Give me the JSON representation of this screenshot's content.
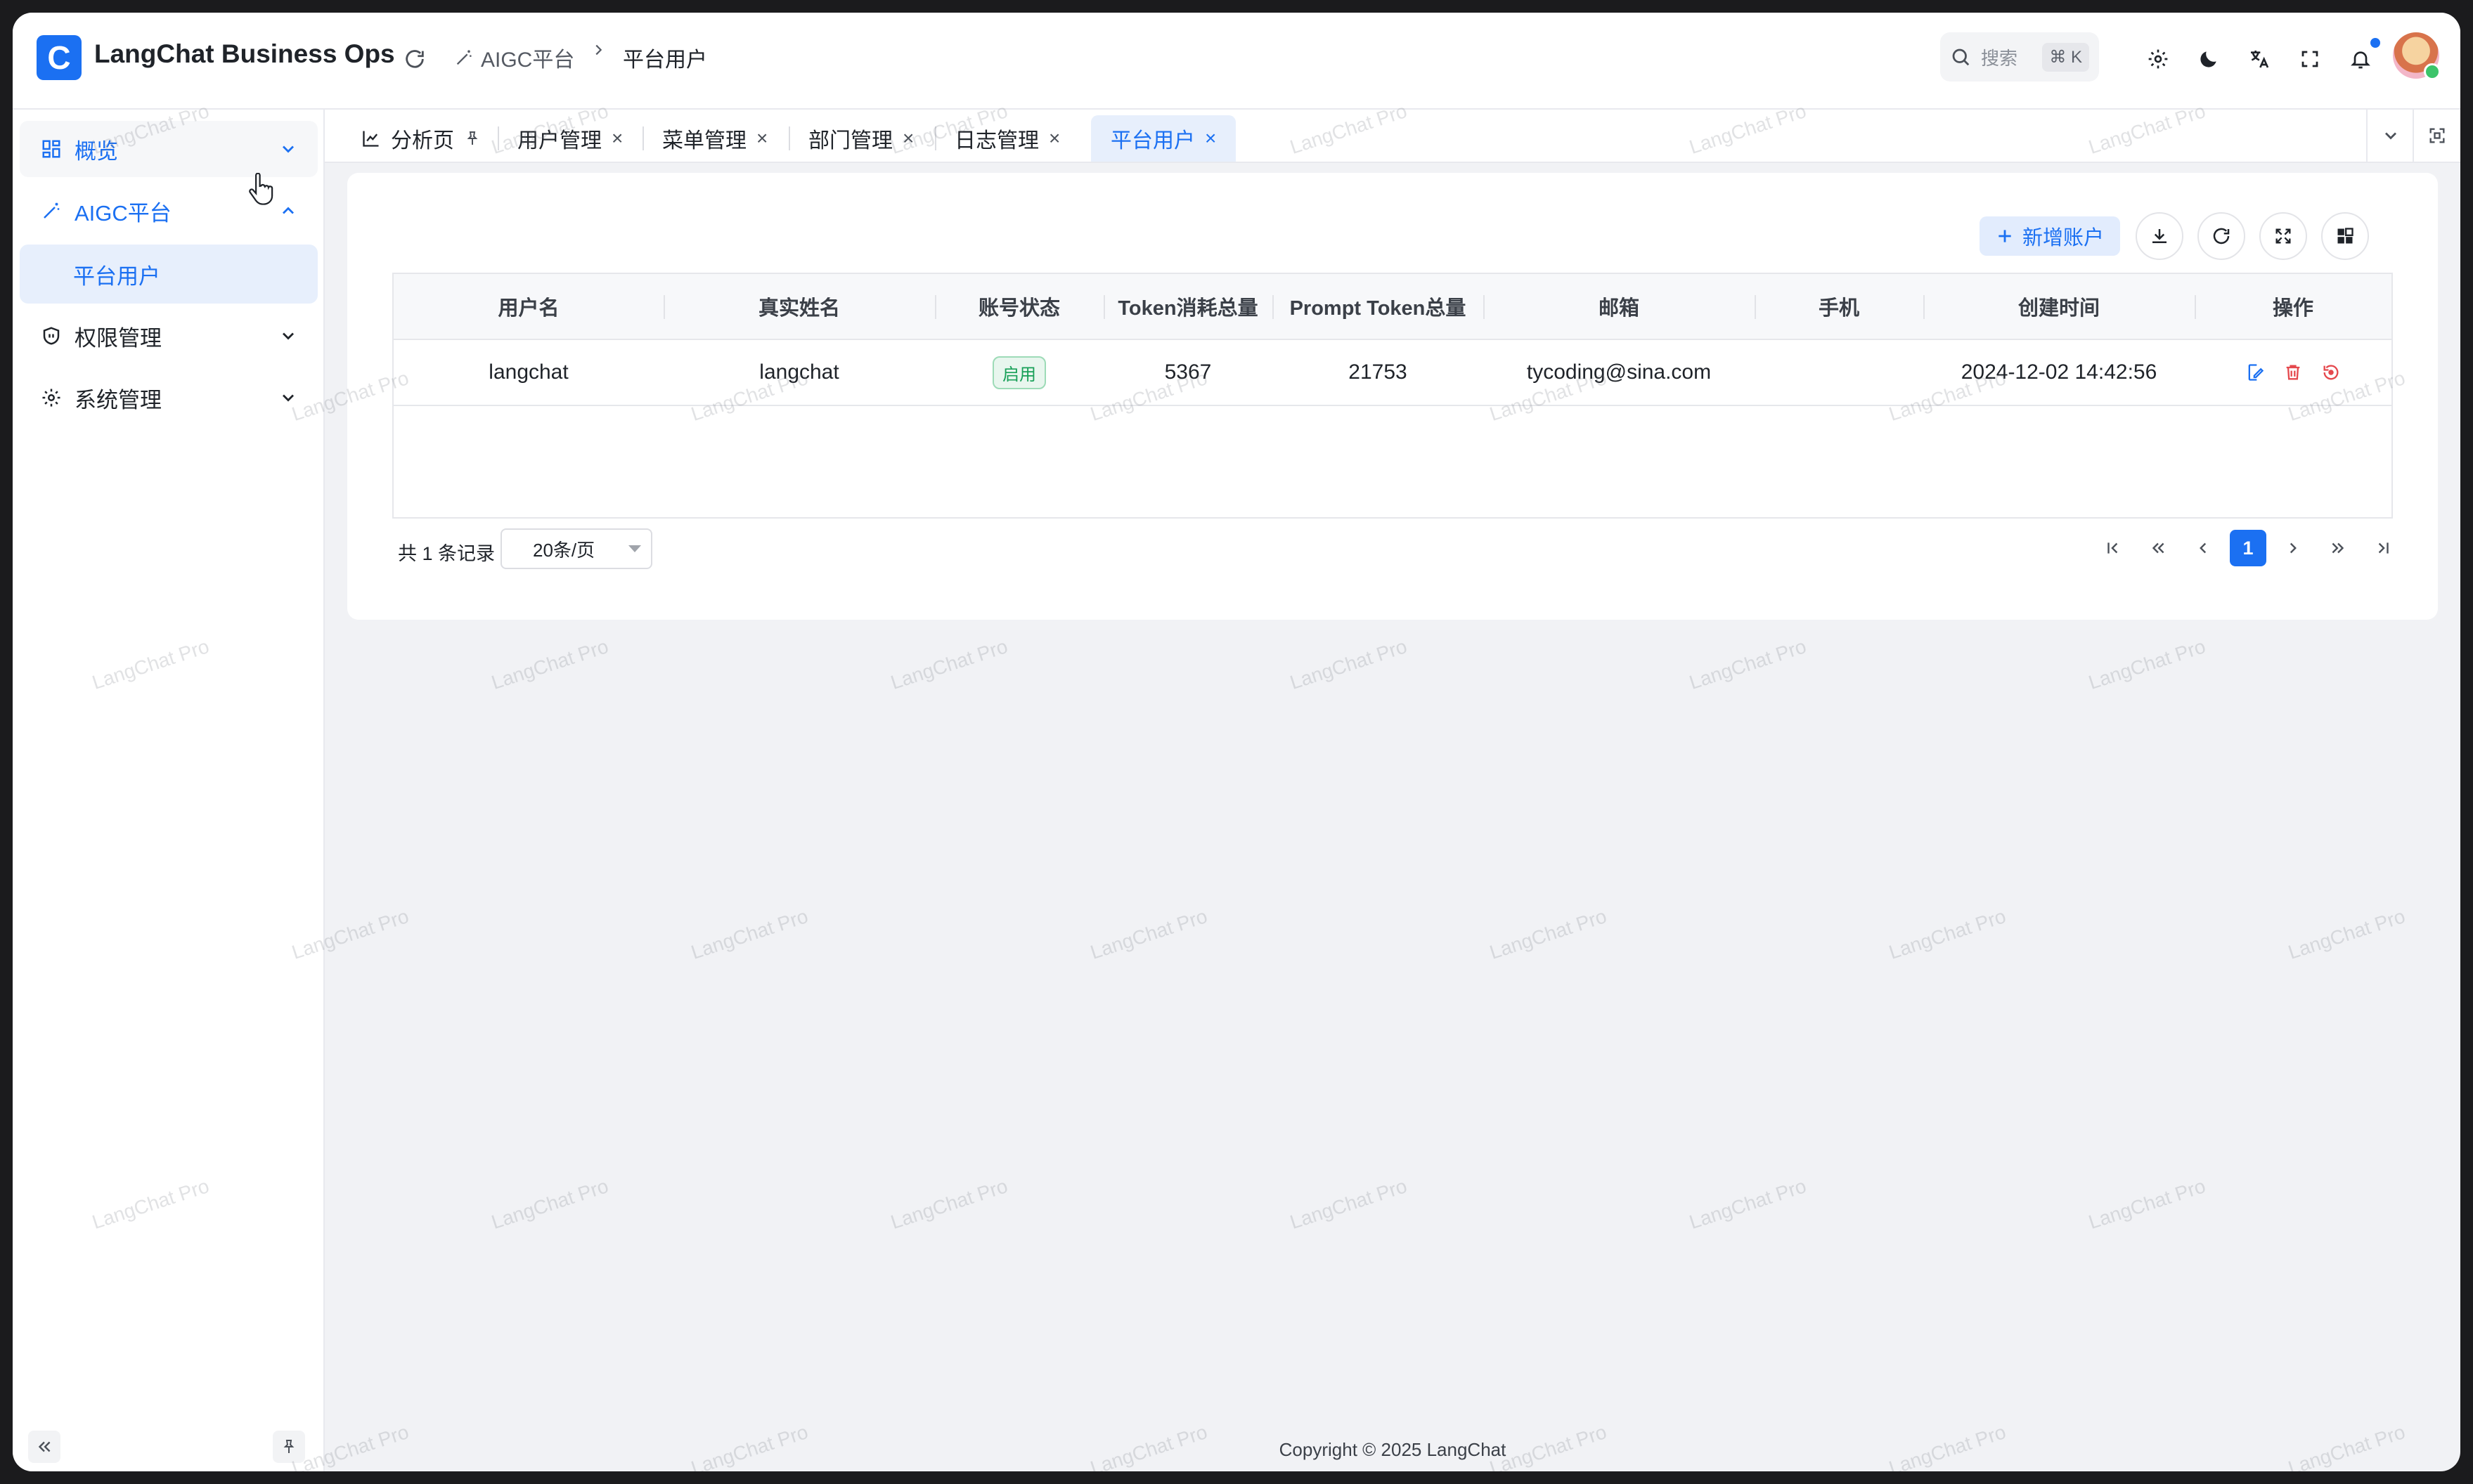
{
  "app": {
    "logo_letter": "C",
    "title": "LangChat Business Ops"
  },
  "breadcrumb": [
    {
      "label": "AIGC平台"
    },
    {
      "label": "平台用户"
    }
  ],
  "search": {
    "placeholder": "搜索",
    "shortcut": "⌘ K"
  },
  "sidebar": {
    "items": [
      {
        "label": "概览",
        "icon": "dashboard-icon"
      },
      {
        "label": "AIGC平台",
        "icon": "magic-wand-icon",
        "expanded": true
      },
      {
        "label": "权限管理",
        "icon": "shield-icon"
      },
      {
        "label": "系统管理",
        "icon": "gear-icon"
      }
    ],
    "sub_items": [
      {
        "label": "平台用户",
        "selected": true
      }
    ]
  },
  "tabs": [
    {
      "label": "分析页",
      "icon": "chart-icon",
      "pinned": true
    },
    {
      "label": "用户管理"
    },
    {
      "label": "菜单管理"
    },
    {
      "label": "部门管理"
    },
    {
      "label": "日志管理"
    },
    {
      "label": "平台用户",
      "active": true
    }
  ],
  "toolbar": {
    "add_label": "新增账户"
  },
  "table": {
    "columns": [
      "用户名",
      "真实姓名",
      "账号状态",
      "Token消耗总量",
      "Prompt Token总量",
      "邮箱",
      "手机",
      "创建时间",
      "操作"
    ],
    "rows": [
      {
        "username": "langchat",
        "realname": "langchat",
        "status": "启用",
        "token_total": "5367",
        "prompt_total": "21753",
        "email": "tycoding@sina.com",
        "phone": "",
        "created": "2024-12-02 14:42:56"
      }
    ]
  },
  "pagination": {
    "total_text": "共 1 条记录",
    "page_size": "20条/页",
    "current_page": "1"
  },
  "footer": {
    "copyright": "Copyright © 2025 LangChat"
  },
  "watermark": "LangChat Pro",
  "colors": {
    "primary": "#1b70f2",
    "success": "#18a058",
    "danger": "#e5484d"
  }
}
